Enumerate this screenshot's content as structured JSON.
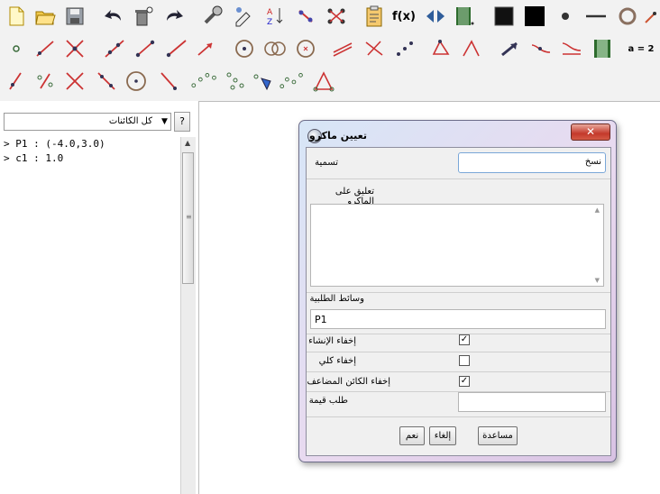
{
  "toolbar": {
    "row1": [
      "new-icon",
      "open-icon",
      "save-icon",
      "undo-icon",
      "delete-icon",
      "redo-icon",
      "properties-icon",
      "format-icon",
      "sort-icon",
      "point-icon",
      "graph-icon",
      "clipboard-icon",
      "function-icon",
      "slider-icon",
      "film-icon",
      "square-filled-icon",
      "square-black-icon",
      "dot-icon",
      "line-segment-icon",
      "circle-icon",
      "more-icon"
    ],
    "row2": [
      "point-small-icon",
      "segment-icon",
      "intersect-icon",
      "line-icon",
      "segment2-icon",
      "ray-icon",
      "vector-icon",
      "circle-point-icon",
      "circle-two-icon",
      "circle-center-icon",
      "parallel-icon",
      "perpendicular-icon",
      "points-icon",
      "polygon-icon",
      "angle-icon",
      "arrow-icon",
      "transform-icon",
      "reflect-icon",
      "media-icon",
      "equation-icon"
    ],
    "row3": [
      "slope-icon",
      "ratio-icon",
      "cross-icon",
      "tangent-icon",
      "circle3-icon",
      "mirror-icon",
      "dots-icon",
      "locus-icon",
      "arrowhead-icon",
      "sequence-icon",
      "triangle-icon"
    ],
    "function_label": "f(x)",
    "equation_label": "a = 2"
  },
  "left_panel": {
    "filter_label": "كل الكائنات",
    "help_label": "?",
    "objects": [
      "> P1 : (-4.0,3.0)",
      "> c1 : 1.0"
    ]
  },
  "dialog": {
    "title": "تعيين ماكرو",
    "close_label": "✕",
    "name_label": "تسمية",
    "name_value": "نسخ",
    "comment_label": "تعليق على الماكرو",
    "comment_value": "",
    "params_label": "وسائط الطلبية",
    "params_value": "P1",
    "hide_construction_label": "إخفاء الإنشاء",
    "hide_construction_checked": true,
    "hide_all_label": "إخفاء كلي",
    "hide_all_checked": false,
    "hide_added_label": "إخفاء الكائن المضاعف",
    "hide_added_checked": true,
    "request_value_label": "طلب قيمة",
    "request_value": "",
    "help_button": "مساعدة",
    "cancel_button": "إلغاء",
    "ok_button": "نعم"
  }
}
